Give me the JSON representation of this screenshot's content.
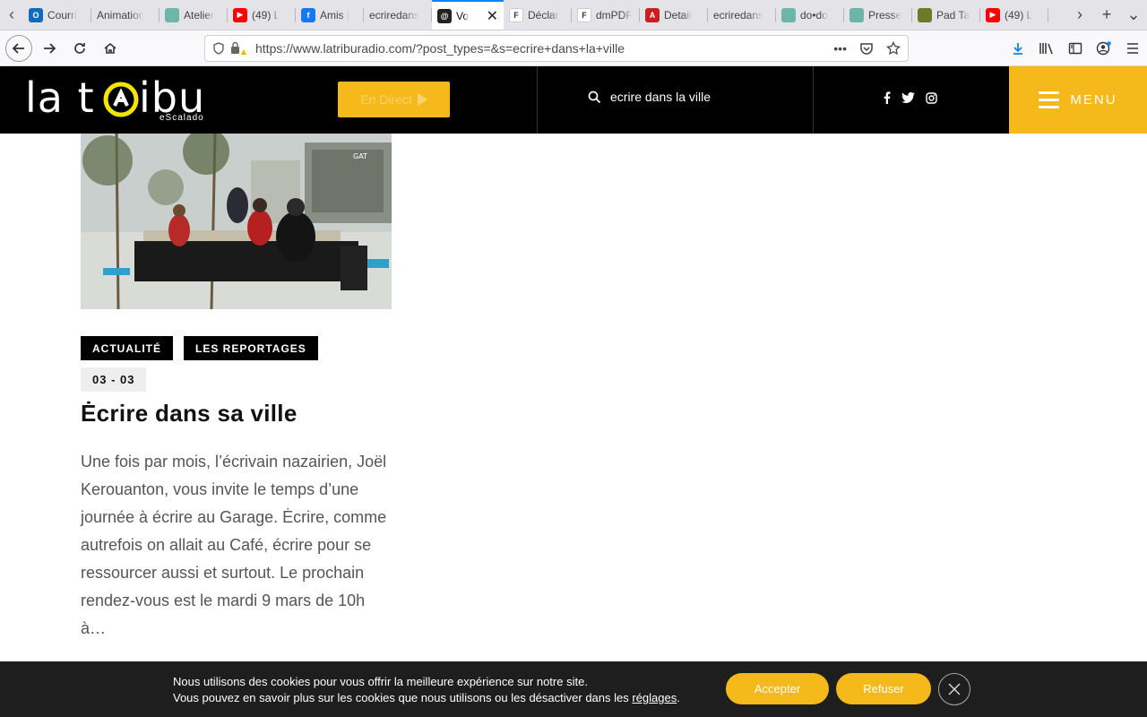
{
  "browser": {
    "tabs": [
      {
        "title": "Courri",
        "color": "#0f6cbd",
        "glyph": "O"
      },
      {
        "title": "Animation",
        "color": "",
        "glyph": ""
      },
      {
        "title": "Atelier",
        "color": "#6bb6a8",
        "glyph": ""
      },
      {
        "title": "(49) L",
        "color": "#ff0000",
        "glyph": "▶"
      },
      {
        "title": "Amis |",
        "color": "#1877f2",
        "glyph": "f"
      },
      {
        "title": "ecriredans",
        "color": "",
        "glyph": ""
      },
      {
        "title": "Vo",
        "color": "#222222",
        "glyph": "@",
        "active": true
      },
      {
        "title": "Déclar",
        "color": "#ffffff",
        "glyph": "F"
      },
      {
        "title": "dmPDF",
        "color": "#ffffff",
        "glyph": "F"
      },
      {
        "title": "Detail",
        "color": "#c81f1f",
        "glyph": "A"
      },
      {
        "title": "ecriredans",
        "color": "",
        "glyph": ""
      },
      {
        "title": "do•do",
        "color": "#6bb6a8",
        "glyph": ""
      },
      {
        "title": "Presse",
        "color": "#6bb6a8",
        "glyph": ""
      },
      {
        "title": "Pad Ta",
        "color": "#6d7a2a",
        "glyph": ""
      },
      {
        "title": "(49) L",
        "color": "#ff0000",
        "glyph": "▶"
      }
    ],
    "url": "https://www.latriburadio.com/?post_types=&s=ecrire+dans+la+ville",
    "url_menu_icon": "•••"
  },
  "header": {
    "logo_word_1": "la t",
    "logo_word_2": "ibu",
    "logo_sub": "eScalado",
    "live_label": "En Direct",
    "search_query": "ecrire dans la ville",
    "menu_label": "MENU",
    "accent_color": "#f5b91b"
  },
  "post": {
    "tags": [
      "ACTUALITÉ",
      "LES REPORTAGES"
    ],
    "date": "03 - 03",
    "title": "Ėcrire dans sa ville",
    "excerpt": "Une fois par mois, l’écrivain nazairien, Joël Kerouanton, vous invite le temps d’une journée à écrire au Garage. Ėcrire, comme autrefois on allait au Café, écrire pour se ressourcer aussi et surtout. Le prochain rendez-vous est le mardi 9 mars de 10h à…",
    "photo_sign": "GAT"
  },
  "cookie": {
    "line1": "Nous utilisons des cookies pour vous offrir la meilleure expérience sur notre site.",
    "line2_prefix": "Vous pouvez en savoir plus sur les cookies que nous utilisons ou les désactiver dans les ",
    "line2_link": "réglages",
    "line2_suffix": ".",
    "accept_label": "Accepter",
    "refuse_label": "Refuser"
  }
}
